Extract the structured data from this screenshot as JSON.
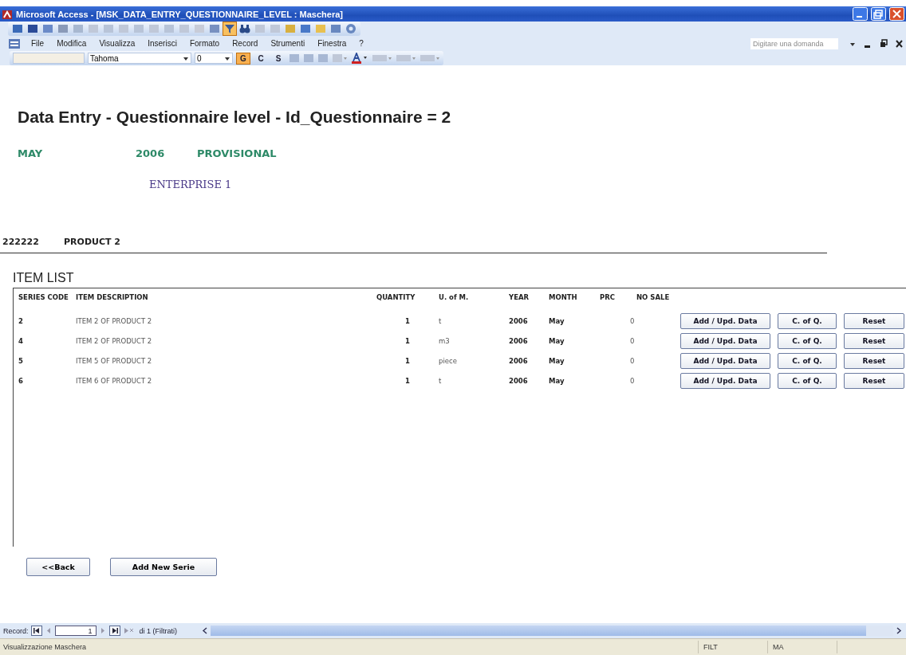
{
  "window": {
    "title": "Microsoft Access - [MSK_DATA_ENTRY_QUESTIONNAIRE_LEVEL : Maschera]"
  },
  "toolbar": {
    "filter_on": true
  },
  "menu": {
    "items": [
      "File",
      "Modifica",
      "Visualizza",
      "Inserisci",
      "Formato",
      "Record",
      "Strumenti",
      "Finestra",
      "?"
    ],
    "help_box": {
      "placeholder": "Digitare una domanda"
    }
  },
  "format_toolbar": {
    "font": "Tahoma",
    "size": "0",
    "style_buttons": [
      {
        "label": "G",
        "selected": true
      },
      {
        "label": "C",
        "selected": false
      },
      {
        "label": "S",
        "selected": false
      }
    ]
  },
  "form": {
    "heading": "Data Entry - Questionnaire level - Id_Questionnaire =  2",
    "month": "MAY",
    "year": "2006",
    "status": "PROVISIONAL",
    "enterprise": "ENTERPRISE 1",
    "product_code": "222222",
    "product_name": "PRODUCT 2",
    "item_list_title": "ITEM LIST",
    "columns": [
      "SERIES CODE",
      "ITEM DESCRIPTION",
      "QUANTITY",
      "U. of M.",
      "YEAR",
      "MONTH",
      "PRC",
      "NO SALE"
    ],
    "rows": [
      {
        "series_code": "2",
        "description": "ITEM 2 OF PRODUCT 2",
        "quantity": "1",
        "unit": "t",
        "year": "2006",
        "month": "May",
        "no_sale": "0",
        "buttons": [
          "Add / Upd. Data",
          "C. of Q.",
          "Reset"
        ]
      },
      {
        "series_code": "4",
        "description": "ITEM 2 OF PRODUCT 2",
        "quantity": "1",
        "unit": "m3",
        "year": "2006",
        "month": "May",
        "no_sale": "0",
        "buttons": [
          "Add / Upd. Data",
          "C. of Q.",
          "Reset"
        ]
      },
      {
        "series_code": "5",
        "description": "ITEM 5 OF PRODUCT 2",
        "quantity": "1",
        "unit": "piece",
        "year": "2006",
        "month": "May",
        "no_sale": "0",
        "buttons": [
          "Add / Upd. Data",
          "C. of Q.",
          "Reset"
        ]
      },
      {
        "series_code": "6",
        "description": "ITEM 6 OF PRODUCT 2",
        "quantity": "1",
        "unit": "t",
        "year": "2006",
        "month": "May",
        "no_sale": "0",
        "buttons": [
          "Add / Upd. Data",
          "C. of Q.",
          "Reset"
        ]
      }
    ],
    "buttons": [
      "<<Back",
      "Add New Serie"
    ]
  },
  "record_nav": {
    "label": "Record:",
    "value": "1",
    "count": "di 1 (Filtrati)"
  },
  "status_bar": {
    "text": "Visualizzazione Maschera",
    "indicators": [
      "FILT",
      "MA"
    ]
  }
}
